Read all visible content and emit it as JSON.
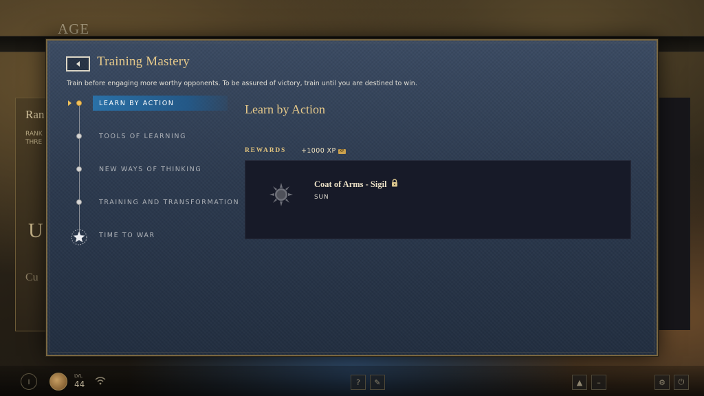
{
  "background": {
    "header_text": "AGE",
    "left_card": {
      "title": "Ran",
      "subtitle_line1": "RANK",
      "subtitle_line2": "THRE",
      "big_text": "U",
      "footer_text": "Cu"
    },
    "bottom_bar": {
      "level_label": "LVL",
      "level_value": "44"
    }
  },
  "modal": {
    "title": "Training Mastery",
    "description": "Train before engaging more worthy opponents. To be assured of victory, train until you are destined to win.",
    "steps": [
      {
        "label": "LEARN BY ACTION",
        "active": true
      },
      {
        "label": "TOOLS OF LEARNING",
        "active": false
      },
      {
        "label": "NEW WAYS OF THINKING",
        "active": false
      },
      {
        "label": "TRAINING AND TRANSFORMATION",
        "active": false
      },
      {
        "label": "TIME TO WAR",
        "active": false
      }
    ],
    "content": {
      "title": "Learn by Action",
      "rewards_label": "REWARDS",
      "xp": "+1000 XP",
      "xp_badge": "XP",
      "reward": {
        "name": "Coat of Arms - Sigil",
        "subtitle": "SUN",
        "icon": "sun-icon",
        "locked": true
      }
    }
  },
  "colors": {
    "accent_gold": "#e6c98a",
    "active_step": "#2878b4",
    "modal_bg": "#2c3a4f",
    "card_bg": "#171a28"
  }
}
